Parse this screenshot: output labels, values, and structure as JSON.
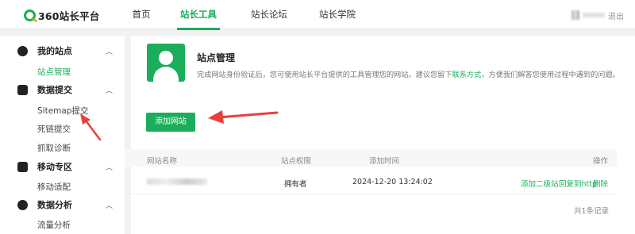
{
  "header": {
    "logo_text": "360站长平台",
    "nav": [
      "首页",
      "站长工具",
      "站长论坛",
      "站长学院"
    ],
    "active_nav": "站长工具",
    "logout": "退出"
  },
  "sidebar": {
    "sections": [
      {
        "title": "我的站点",
        "icon": "user-icon",
        "items": [
          "站点管理"
        ]
      },
      {
        "title": "数据提交",
        "icon": "upload-icon",
        "items": [
          "Sitemap提交",
          "死链提交",
          "抓取诊断"
        ]
      },
      {
        "title": "移动专区",
        "icon": "mobile-icon",
        "items": [
          "移动适配"
        ]
      },
      {
        "title": "数据分析",
        "icon": "chart-icon",
        "items": [
          "流量分析"
        ]
      }
    ],
    "active_item": "站点管理"
  },
  "main": {
    "title": "站点管理",
    "desc_before": "完成网站身份验证后，您可使用站长平台提供的工具管理您的网站。建议您留下",
    "desc_link": "联系方式",
    "desc_after": "，方便我们解答您使用过程中遇到的问题。",
    "add_button": "添加网站",
    "table": {
      "headers": [
        "网站名称",
        "站点权限",
        "添加时间",
        "操作"
      ],
      "rows": [
        {
          "permission": "拥有者",
          "time": "2024-12-20 13:24:02",
          "actions": [
            "添加二级站",
            "回复到http",
            "删除"
          ]
        }
      ],
      "total": "共1条记录"
    }
  },
  "colors": {
    "accent": "#1aad5a",
    "arrow": "#e8413b"
  }
}
